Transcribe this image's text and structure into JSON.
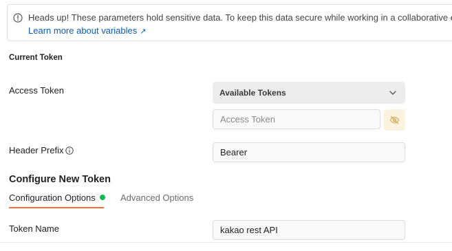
{
  "alert": {
    "message": "Heads up! These parameters hold sensitive data. To keep this data secure while working in a collaborative en",
    "link_label": "Learn more about variables",
    "link_arrow": "↗",
    "icon": "exclamation-circle-icon"
  },
  "current_token": {
    "section_label": "Current Token",
    "access_token_label": "Access Token",
    "dropdown_label": "Available Tokens",
    "token_placeholder": "Access Token",
    "token_value": "",
    "header_prefix_label": "Header Prefix",
    "header_prefix_value": "Bearer",
    "visibility_icon": "eye-slash-icon"
  },
  "configure": {
    "heading": "Configure New Token",
    "tabs": [
      {
        "label": "Configuration Options",
        "active": true,
        "has_dot": true
      },
      {
        "label": "Advanced Options",
        "active": false
      }
    ],
    "token_name_label": "Token Name",
    "token_name_value": "kakao rest API"
  },
  "colors": {
    "accent_orange": "#ff6c37",
    "status_green": "#0cbb52",
    "link_blue": "#0b5cbd",
    "warning_bg": "#fbf3e0"
  }
}
